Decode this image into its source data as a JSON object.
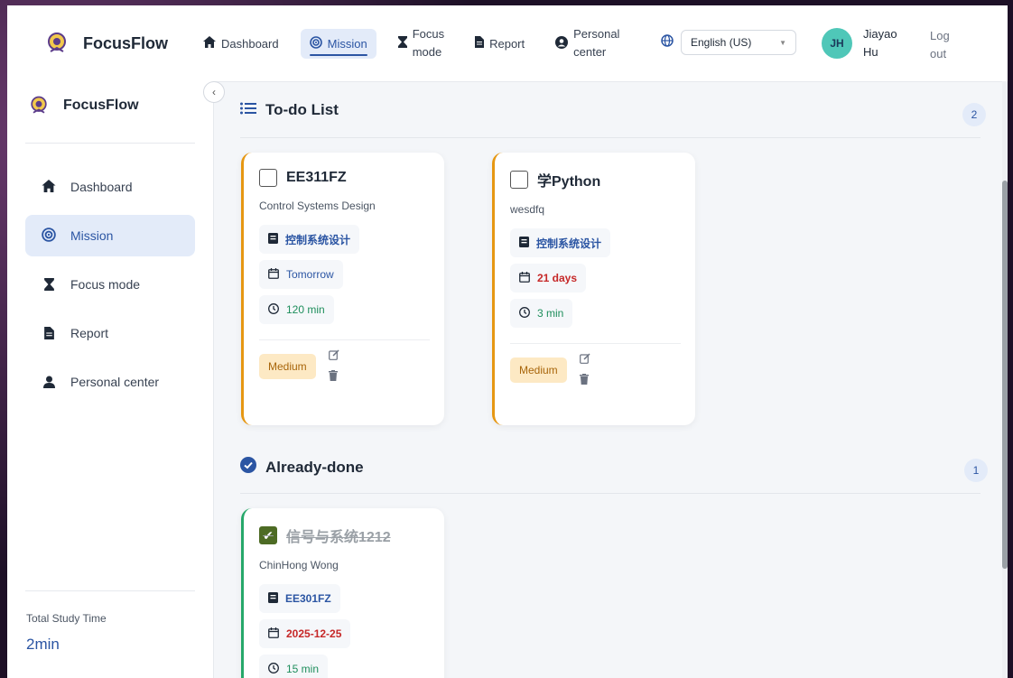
{
  "app": {
    "name": "FocusFlow"
  },
  "topnav": {
    "items": [
      {
        "label": "Dashboard",
        "icon": "home-icon"
      },
      {
        "label": "Mission",
        "icon": "target-icon",
        "active": true
      },
      {
        "label": "Focus mode",
        "label_l1": "Focus",
        "label_l2": "mode",
        "icon": "hourglass-icon"
      },
      {
        "label": "Report",
        "icon": "file-icon"
      },
      {
        "label": "Personal center",
        "label_l1": "Personal",
        "label_l2": "center",
        "icon": "user-circle-icon"
      }
    ],
    "language": {
      "value": "English (US)",
      "icon": "globe-icon"
    },
    "user": {
      "initials": "JH",
      "name_l1": "Jiayao",
      "name_l2": "Hu"
    },
    "logout_l1": "Log",
    "logout_l2": "out"
  },
  "sidebar": {
    "brand": "FocusFlow",
    "items": [
      {
        "label": "Dashboard",
        "icon": "home-icon"
      },
      {
        "label": "Mission",
        "icon": "target-icon",
        "active": true
      },
      {
        "label": "Focus mode",
        "icon": "hourglass-icon"
      },
      {
        "label": "Report",
        "icon": "file-icon"
      },
      {
        "label": "Personal center",
        "icon": "user-icon"
      }
    ],
    "study_label": "Total Study Time",
    "study_value": "2min"
  },
  "todo": {
    "title": "To-do List",
    "count": "2",
    "cards": [
      {
        "title": "EE311FZ",
        "subtitle": "Control Systems Design",
        "course": "控制系统设计",
        "due": "Tomorrow",
        "duration": "120 min",
        "priority": "Medium"
      },
      {
        "title": "学Python",
        "subtitle": "wesdfq",
        "course": "控制系统设计",
        "due": "21 days",
        "duration": "3 min",
        "priority": "Medium"
      }
    ]
  },
  "done": {
    "title": "Already-done",
    "count": "1",
    "cards": [
      {
        "title": "信号与系统1212",
        "subtitle": "ChinHong Wong",
        "course": "EE301FZ",
        "due": "2025-12-25",
        "duration": "15 min"
      }
    ]
  },
  "colors": {
    "accent": "#2b55a3",
    "todo_border": "#e69712",
    "done_border": "#26a86a",
    "avatar": "#4fc7b8"
  }
}
